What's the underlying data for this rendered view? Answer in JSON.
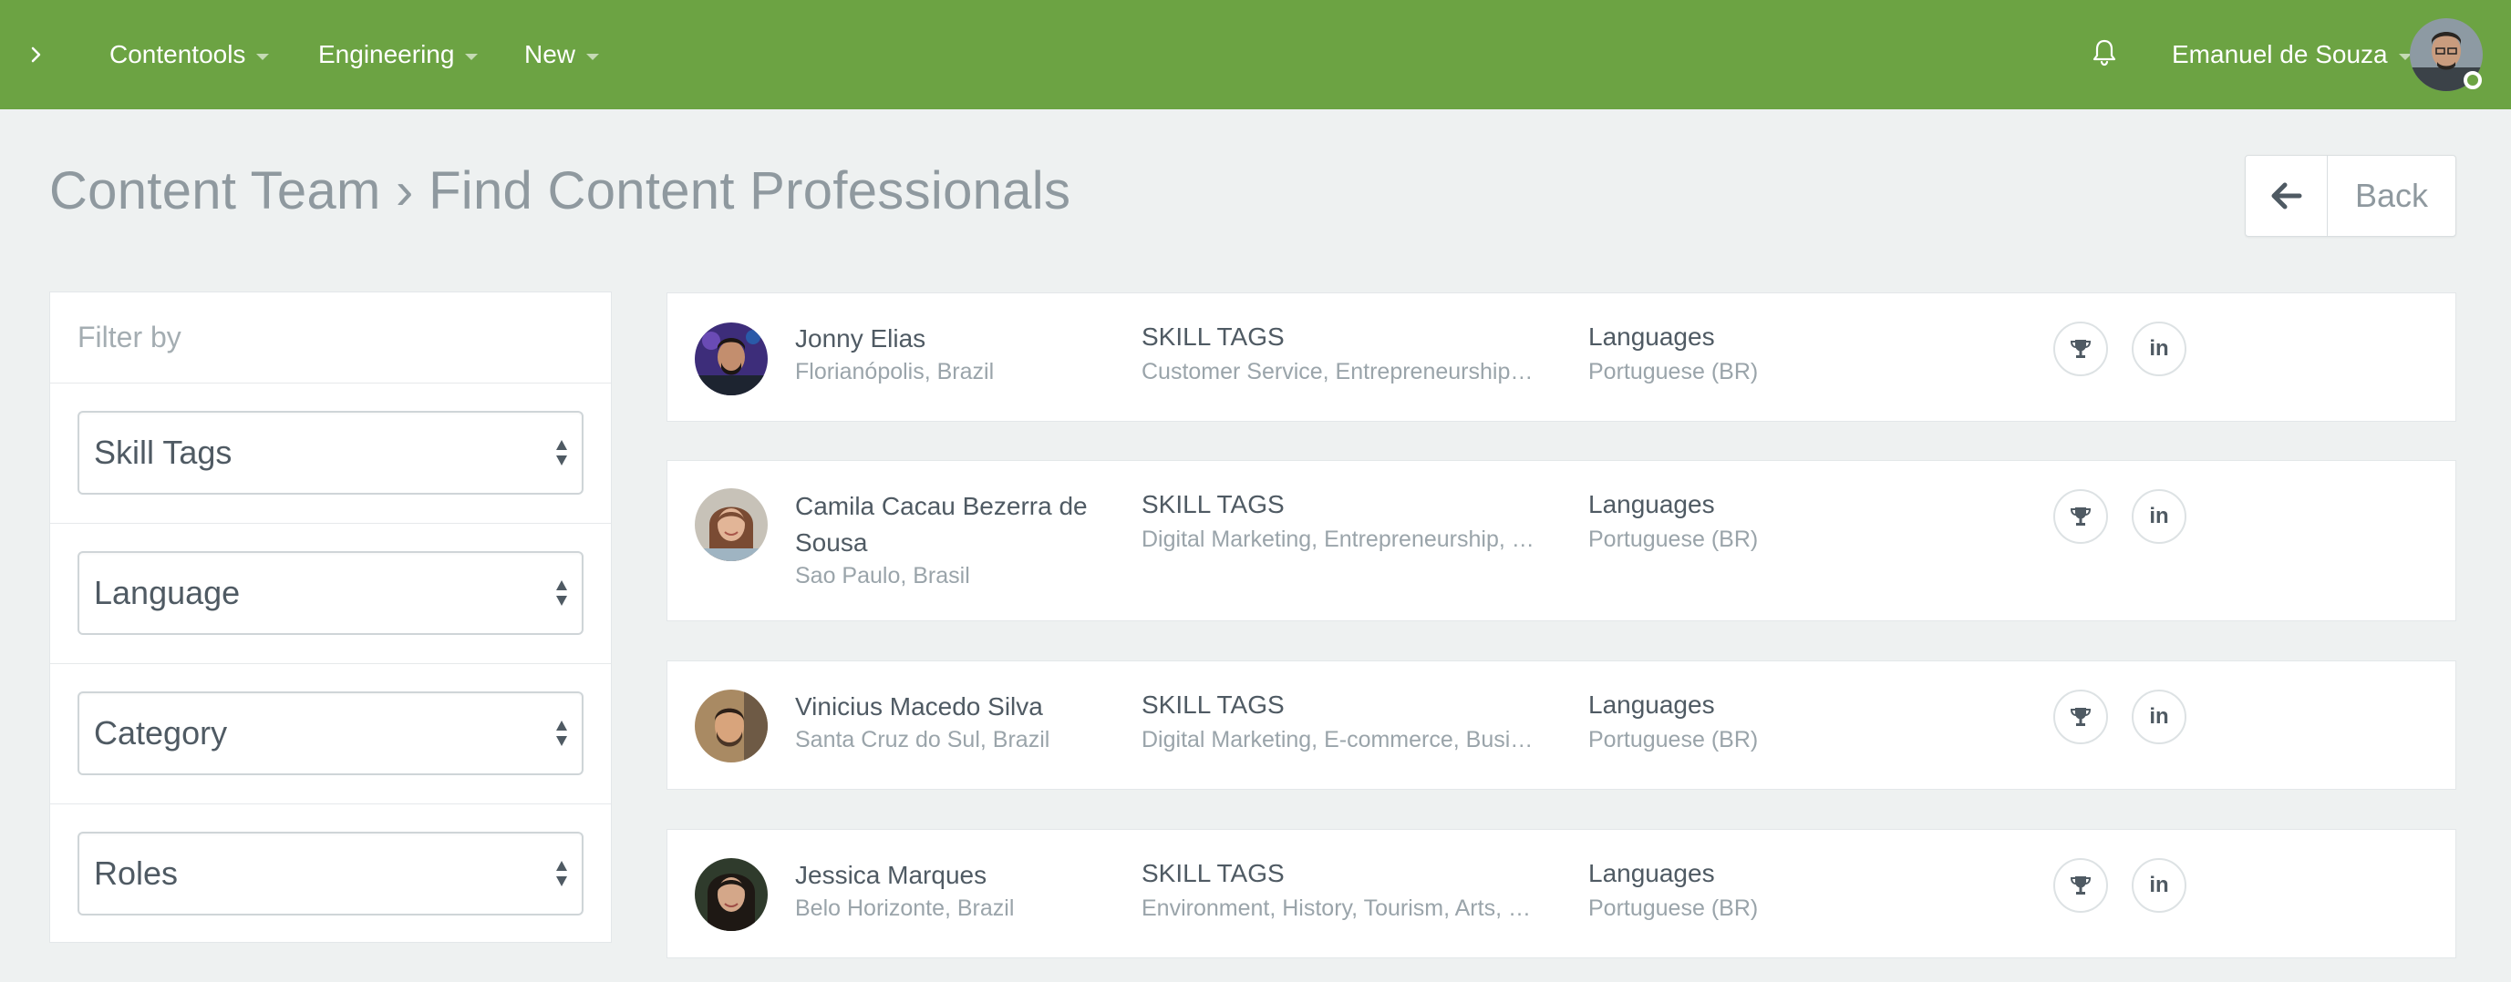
{
  "topbar": {
    "toggle_icon": "chevron-right-icon",
    "nav": [
      {
        "label": "Contentools"
      },
      {
        "label": "Engineering"
      },
      {
        "label": "New"
      }
    ],
    "notifications_icon": "bell-icon",
    "user_name": "Emanuel de Souza",
    "brand_color": "#6ca343"
  },
  "header": {
    "title": "Content Team › Find Content Professionals",
    "back_label": "Back",
    "back_icon": "arrow-left-icon"
  },
  "filters": {
    "title": "Filter by",
    "selects": [
      {
        "label": "Skill Tags"
      },
      {
        "label": "Language"
      },
      {
        "label": "Category"
      },
      {
        "label": "Roles"
      }
    ]
  },
  "results": [
    {
      "name": "Jonny Elias",
      "location": "Florianópolis, Brazil",
      "skills_heading": "SKILL TAGS",
      "skills": "Customer Service, Entrepreneurship, ...",
      "languages_heading": "Languages",
      "languages": "Portuguese (BR)"
    },
    {
      "name": "Camila Cacau Bezerra de Sousa",
      "location": "Sao Paulo, Brasil",
      "skills_heading": "SKILL TAGS",
      "skills": "Digital Marketing, Entrepreneurship, N..",
      "languages_heading": "Languages",
      "languages": "Portuguese (BR)"
    },
    {
      "name": "Vinicius Macedo Silva",
      "location": "Santa Cruz do Sul, Brazil",
      "skills_heading": "SKILL TAGS",
      "skills": "Digital Marketing, E-commerce, Busin...",
      "languages_heading": "Languages",
      "languages": "Portuguese (BR)"
    },
    {
      "name": "Jessica Marques",
      "location": "Belo Horizonte, Brazil",
      "skills_heading": "SKILL TAGS",
      "skills": "Environment, History, Tourism, Arts, F...",
      "languages_heading": "Languages",
      "languages": "Portuguese (BR)"
    }
  ],
  "result_action_icons": [
    "trophy-icon",
    "linkedin-icon"
  ],
  "linkedin_glyph": "in"
}
